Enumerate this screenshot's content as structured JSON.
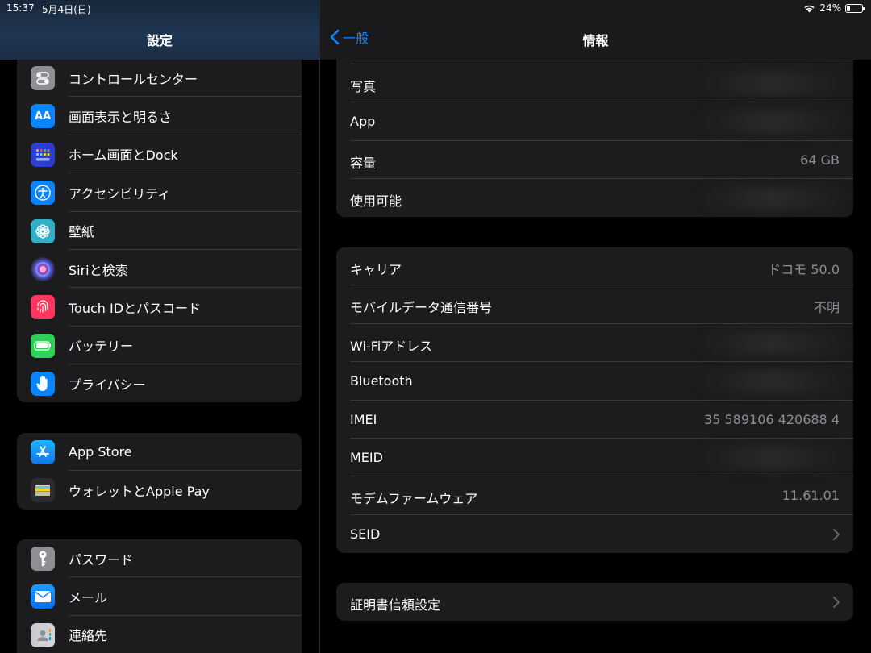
{
  "status": {
    "time": "15:37",
    "date": "5月4日(日)",
    "battery": "24%",
    "battery_level": 0.24
  },
  "sidebar": {
    "title": "設定",
    "group1": [
      {
        "label": "コントロールセンター",
        "icon": "control-center-icon",
        "color": "#8e8e93"
      },
      {
        "label": "画面表示と明るさ",
        "icon": "display-brightness-icon",
        "color": "#0a84ff"
      },
      {
        "label": "ホーム画面とDock",
        "icon": "home-screen-icon",
        "color": "#2c3ecf"
      },
      {
        "label": "アクセシビリティ",
        "icon": "accessibility-icon",
        "color": "#0a84ff"
      },
      {
        "label": "壁紙",
        "icon": "wallpaper-icon",
        "color": "#30b0c7"
      },
      {
        "label": "Siriと検索",
        "icon": "siri-icon",
        "color": "#2b1a3a"
      },
      {
        "label": "Touch IDとパスコード",
        "icon": "fingerprint-icon",
        "color": "#ff375f"
      },
      {
        "label": "バッテリー",
        "icon": "battery-icon",
        "color": "#30d158"
      },
      {
        "label": "プライバシー",
        "icon": "hand-icon",
        "color": "#0a84ff"
      }
    ],
    "group2": [
      {
        "label": "App Store",
        "icon": "app-store-icon",
        "color": "#0a84ff"
      },
      {
        "label": "ウォレットとApple Pay",
        "icon": "wallet-icon",
        "color": "#2c2c2e"
      }
    ],
    "group3": [
      {
        "label": "パスワード",
        "icon": "key-icon",
        "color": "#8e8e93"
      },
      {
        "label": "メール",
        "icon": "mail-icon",
        "color": "#0a84ff"
      },
      {
        "label": "連絡先",
        "icon": "contacts-icon",
        "color": "#a2845e"
      }
    ]
  },
  "detail": {
    "back_label": "一般",
    "title": "情報",
    "group1": [
      {
        "label": "写真",
        "value": ""
      },
      {
        "label": "App",
        "value": ""
      },
      {
        "label": "容量",
        "value": "64 GB"
      },
      {
        "label": "使用可能",
        "value": ""
      }
    ],
    "group2": [
      {
        "label": "キャリア",
        "value": "ドコモ 50.0"
      },
      {
        "label": "モバイルデータ通信番号",
        "value": "不明"
      },
      {
        "label": "Wi-Fiアドレス",
        "value": ""
      },
      {
        "label": "Bluetooth",
        "value": ""
      },
      {
        "label": "IMEI",
        "value": "35 589106 420688 4"
      },
      {
        "label": "MEID",
        "value": ""
      },
      {
        "label": "モデムファームウェア",
        "value": "11.61.01"
      },
      {
        "label": "SEID",
        "value": ""
      }
    ],
    "group3": [
      {
        "label": "証明書信頼設定",
        "value": ""
      }
    ]
  }
}
